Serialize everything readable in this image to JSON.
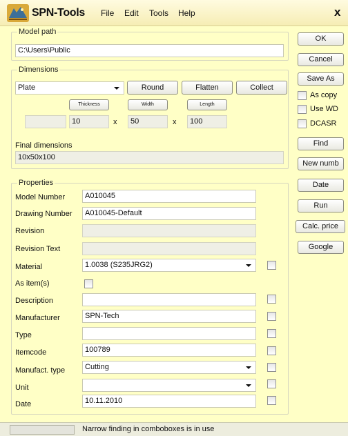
{
  "app": {
    "title": "SPN-Tools",
    "menu": [
      "File",
      "Edit",
      "Tools",
      "Help"
    ],
    "close": "x",
    "icon": "spn-tools-logo-icon"
  },
  "model_path": {
    "legend": "Model path",
    "value": "C:\\Users\\Public"
  },
  "dimensions": {
    "legend": "Dimensions",
    "type_value": "Plate",
    "round_label": "Round",
    "flatten_label": "Flatten",
    "collect_label": "Collect",
    "thickness_label": "Thickness",
    "width_label": "Width",
    "length_label": "Length",
    "thickness_value": "10",
    "width_value": "50",
    "length_value": "100",
    "times": "x",
    "final_label": "Final dimensions",
    "final_value": "10x50x100"
  },
  "properties": {
    "legend": "Properties",
    "rows": [
      {
        "label": "Model Number",
        "value": ""
      },
      {
        "label": "Drawing Number",
        "value": ""
      },
      {
        "label": "Revision",
        "value": ""
      },
      {
        "label": "Revision Text",
        "value": ""
      },
      {
        "label": "Material",
        "value": ""
      },
      {
        "label": "As item(s)",
        "value": ""
      },
      {
        "label": "Description",
        "value": ""
      },
      {
        "label": "Manufacturer",
        "value": ""
      },
      {
        "label": "Type",
        "value": ""
      },
      {
        "label": "Itemcode",
        "value": ""
      },
      {
        "label": "Manufact. type",
        "value": ""
      },
      {
        "label": "Unit",
        "value": ""
      },
      {
        "label": "Date",
        "value": ""
      }
    ],
    "model_number": "A010045",
    "drawing_number": "A010045-Default",
    "revision": "",
    "revision_text": "",
    "material": "1.0038 (S235JRG2)",
    "description": "",
    "manufacturer": "SPN-Tech",
    "type": "",
    "itemcode": "100789",
    "manufact_type": "Cutting",
    "unit": "",
    "date": "10.11.2010"
  },
  "sidebar": {
    "ok": "OK",
    "cancel": "Cancel",
    "save_as": "Save As",
    "as_copy": "As copy",
    "use_wd": "Use WD",
    "dcasr": "DCASR",
    "find": "Find",
    "new_numb": "New numb",
    "date": "Date",
    "run": "Run",
    "calc_price": "Calc. price",
    "google": "Google"
  },
  "status": {
    "text": "Narrow finding in comboboxes is in use"
  }
}
